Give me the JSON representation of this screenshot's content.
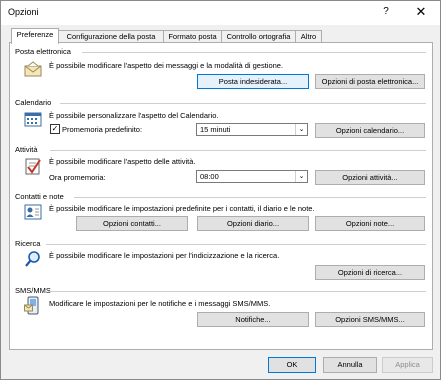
{
  "window": {
    "title": "Opzioni",
    "help": "?",
    "close": "✕"
  },
  "tabs": [
    {
      "label": "Preferenze"
    },
    {
      "label": "Configurazione della posta"
    },
    {
      "label": "Formato posta"
    },
    {
      "label": "Controllo ortografia"
    },
    {
      "label": "Altro"
    }
  ],
  "sections": {
    "email": {
      "title": "Posta elettronica",
      "desc1": "È possibile modificare l'aspetto dei messaggi e la modalità di gestione.",
      "btn_junk": "Posta indesiderata...",
      "btn_options": "Opzioni di posta elettronica..."
    },
    "calendar": {
      "title": "Calendario",
      "desc": "È possibile personalizzare l'aspetto del Calendario.",
      "reminder_label": "Promemoria predefinito:",
      "reminder_value": "15 minuti",
      "btn_options": "Opzioni calendario..."
    },
    "tasks": {
      "title": "Attività",
      "desc": "È possibile modificare l'aspetto delle attività.",
      "reminder_label": "Ora promemoria:",
      "reminder_value": "08:00",
      "btn_options": "Opzioni attività..."
    },
    "contacts": {
      "title": "Contatti e note",
      "desc": "È possibile modificare le impostazioni predefinite per i contatti, il diario e le note.",
      "btn_contacts": "Opzioni contatti...",
      "btn_journal": "Opzioni diario...",
      "btn_notes": "Opzioni note..."
    },
    "search": {
      "title": "Ricerca",
      "desc": "È possibile modificare le impostazioni per l'indicizzazione e la ricerca.",
      "btn_options": "Opzioni di ricerca..."
    },
    "sms": {
      "title": "SMS/MMS",
      "desc": "Modificare le impostazioni per le notifiche e i messaggi SMS/MMS.",
      "btn_notifications": "Notifiche...",
      "btn_options": "Opzioni SMS/MMS..."
    }
  },
  "footer": {
    "ok": "OK",
    "cancel": "Annulla",
    "apply": "Applica"
  }
}
